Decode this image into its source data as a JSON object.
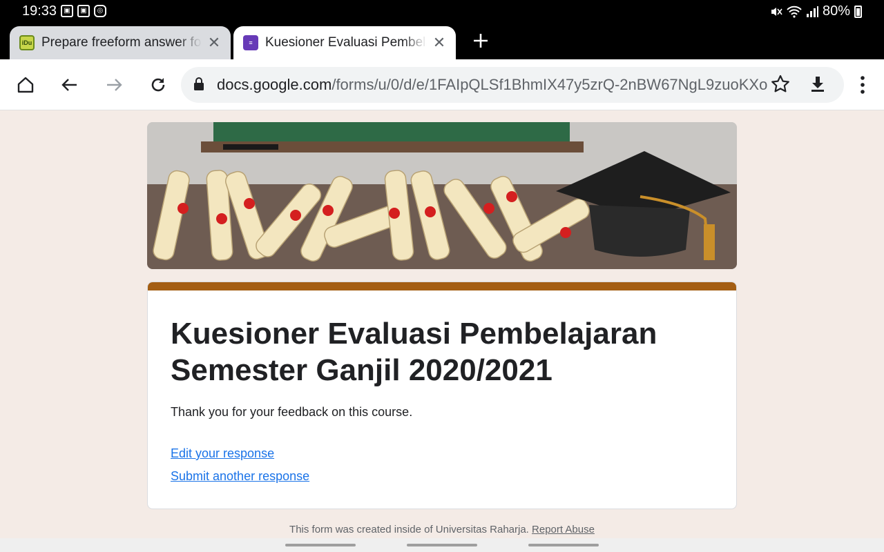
{
  "status_bar": {
    "time": "19:33",
    "battery": "80%"
  },
  "tabs": [
    {
      "title": "Prepare freeform answer for",
      "close": "✕"
    },
    {
      "title": "Kuesioner Evaluasi Pembelajaran",
      "close": "✕"
    }
  ],
  "toolbar": {
    "url_host": "docs.google.com",
    "url_path": "/forms/u/0/d/e/1FAIpQLSf1BhmIX47y5zrQ-2nBW67NgL9zuoKXo"
  },
  "form": {
    "title": "Kuesioner Evaluasi Pembelajaran Semester Ganjil 2020/2021",
    "confirmation": "Thank you for your feedback on this course.",
    "edit_link": "Edit your response",
    "submit_another_link": "Submit another response",
    "accent_color": "#a45e13"
  },
  "footer": {
    "text": "This form was created inside of Universitas Raharja.",
    "report_link": "Report Abuse"
  }
}
